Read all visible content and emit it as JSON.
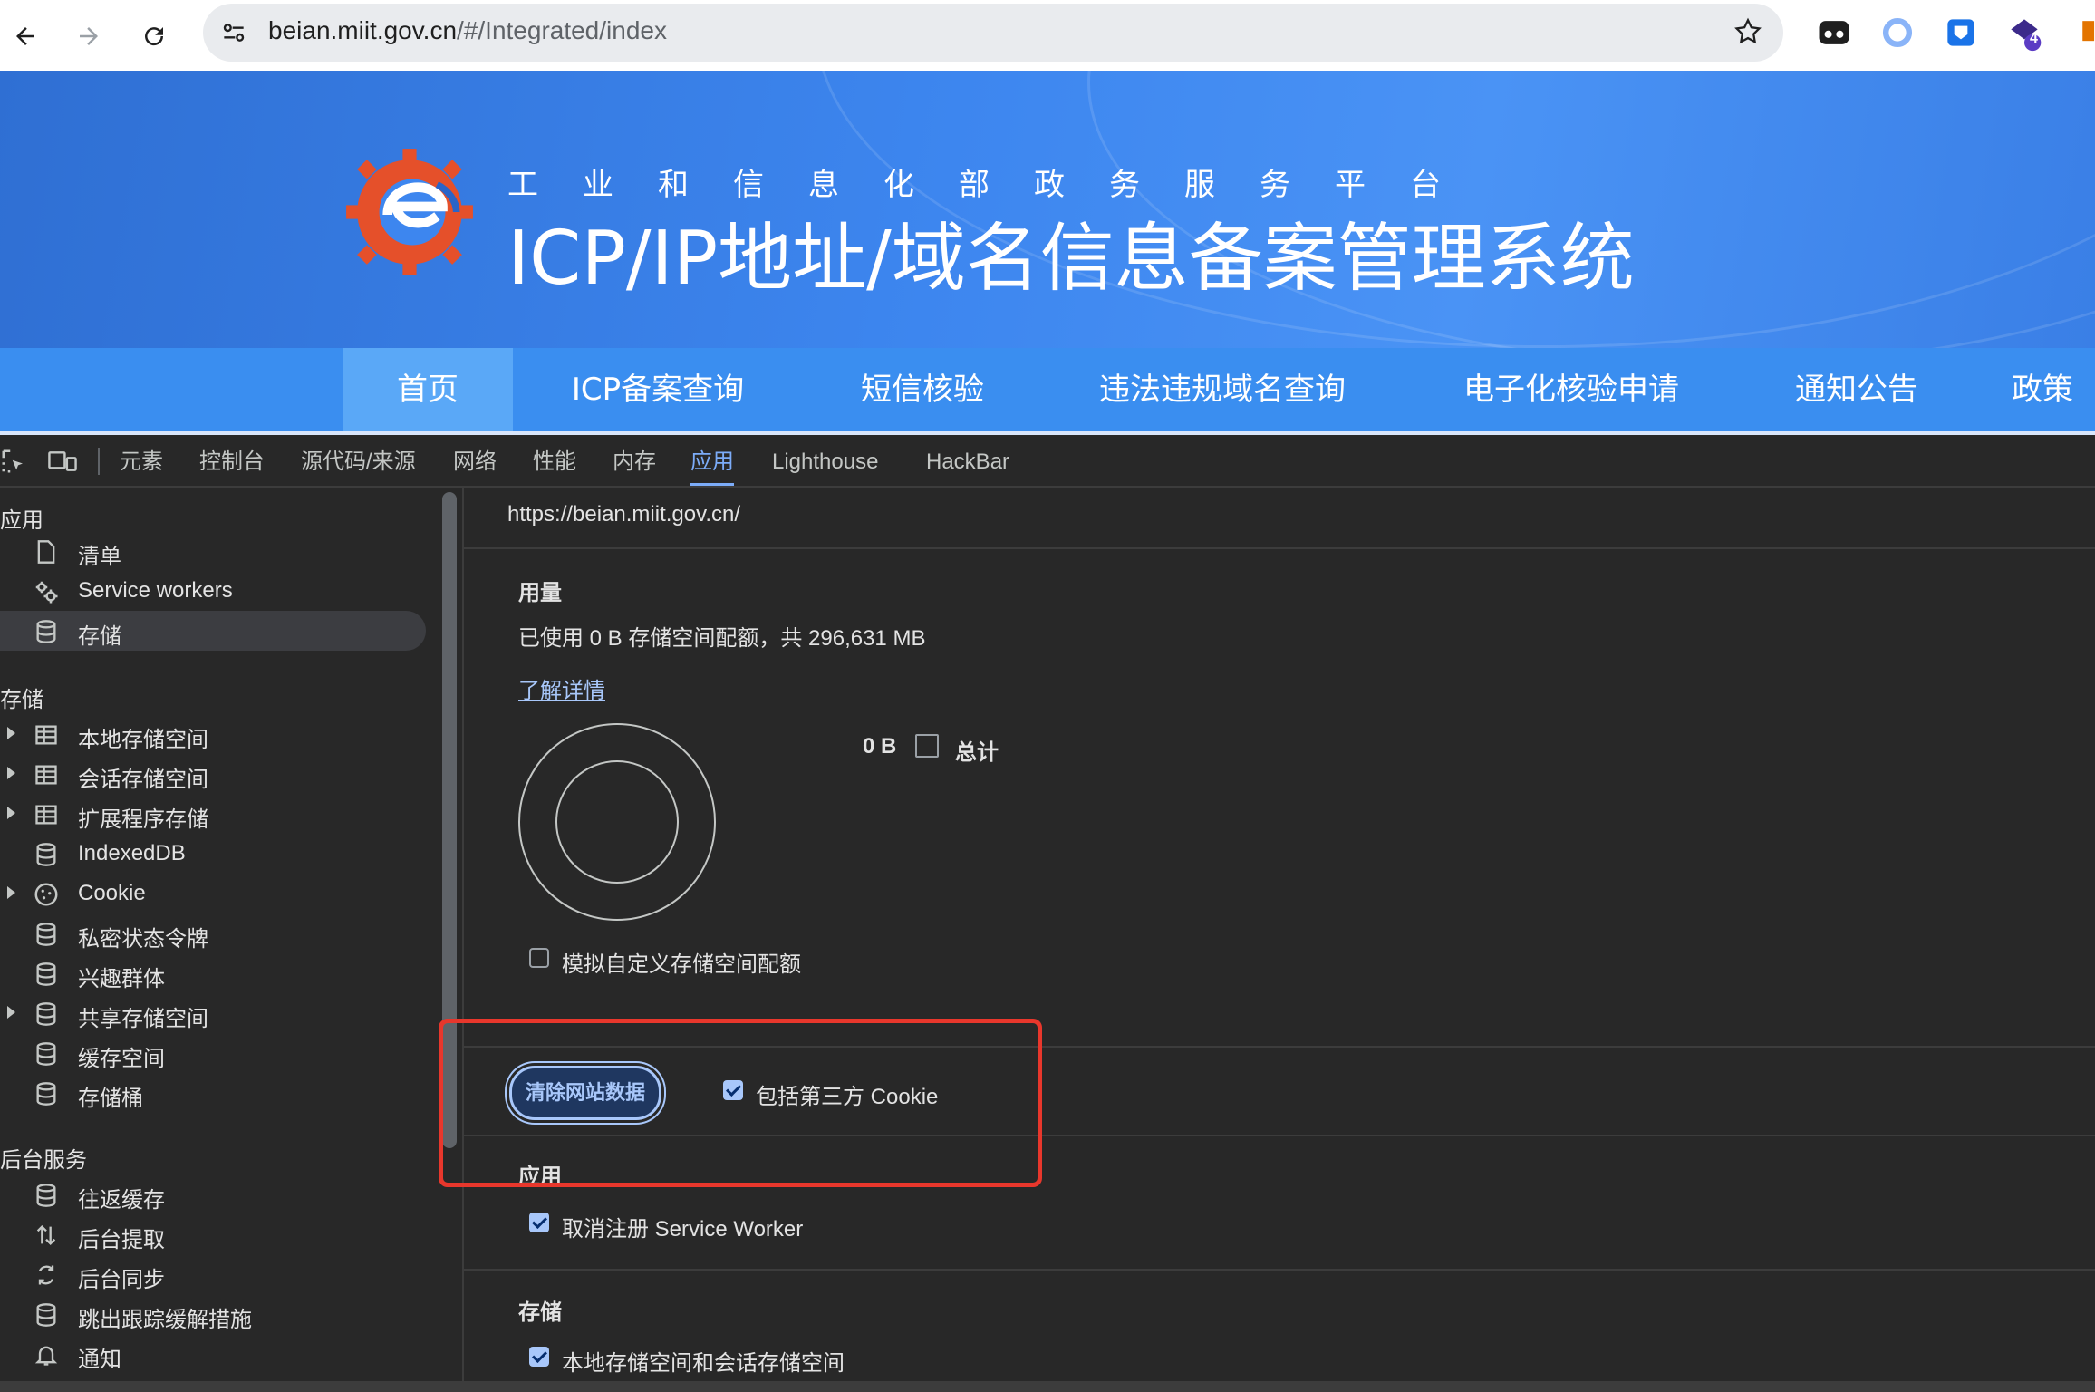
{
  "browser": {
    "url_host": "beian.miit.gov.cn",
    "url_path": "/#/Integrated/index",
    "extension_badge": "4"
  },
  "site": {
    "subtitle": "工业和信息化部政务服务平台",
    "title": "ICP/IP地址/域名信息备案管理系统",
    "nav": [
      "首页",
      "ICP备案查询",
      "短信核验",
      "违法违规域名查询",
      "电子化核验申请",
      "通知公告",
      "政策"
    ]
  },
  "devtools": {
    "tabs": [
      "元素",
      "控制台",
      "源代码/来源",
      "网络",
      "性能",
      "内存",
      "应用",
      "Lighthouse",
      "HackBar"
    ],
    "active_tab": "应用",
    "sidebar": {
      "app_header": "应用",
      "app_items": [
        {
          "label": "清单",
          "icon": "document-icon"
        },
        {
          "label": "Service workers",
          "icon": "gears-icon"
        },
        {
          "label": "存储",
          "icon": "database-icon"
        }
      ],
      "storage_header": "存储",
      "storage_items": [
        {
          "label": "本地存储空间",
          "icon": "table-icon"
        },
        {
          "label": "会话存储空间",
          "icon": "table-icon"
        },
        {
          "label": "扩展程序存储",
          "icon": "table-icon"
        },
        {
          "label": "IndexedDB",
          "icon": "database-icon"
        },
        {
          "label": "Cookie",
          "icon": "cookie-icon"
        },
        {
          "label": "私密状态令牌",
          "icon": "database-icon"
        },
        {
          "label": "兴趣群体",
          "icon": "database-icon"
        },
        {
          "label": "共享存储空间",
          "icon": "database-icon"
        },
        {
          "label": "缓存空间",
          "icon": "database-icon"
        },
        {
          "label": "存储桶",
          "icon": "database-icon"
        }
      ],
      "bg_header": "后台服务",
      "bg_items": [
        {
          "label": "往返缓存",
          "icon": "database-icon"
        },
        {
          "label": "后台提取",
          "icon": "fetch-icon"
        },
        {
          "label": "后台同步",
          "icon": "sync-icon"
        },
        {
          "label": "跳出跟踪缓解措施",
          "icon": "database-icon"
        },
        {
          "label": "通知",
          "icon": "bell-icon"
        }
      ]
    },
    "main": {
      "origin": "https://beian.miit.gov.cn/",
      "usage_header": "用量",
      "usage_text": "已使用 0 B 存储空间配额，共 296,631 MB",
      "learn_more": "了解详情",
      "legend_value": "0 B",
      "legend_label": "总计",
      "simulate_quota": "模拟自定义存储空间配额",
      "clear_button": "清除网站数据",
      "third_party_cookie": "包括第三方 Cookie",
      "app_section": "应用",
      "unregister_sw": "取消注册 Service Worker",
      "storage_section": "存储",
      "local_session": "本地存储空间和会话存储空间"
    }
  },
  "colors": {
    "banner": "#3d86ef",
    "nav": "#3a8ef0",
    "nav_active": "#5aa8f7",
    "accent": "#7cacf8",
    "highlight_box": "#e8372c"
  }
}
